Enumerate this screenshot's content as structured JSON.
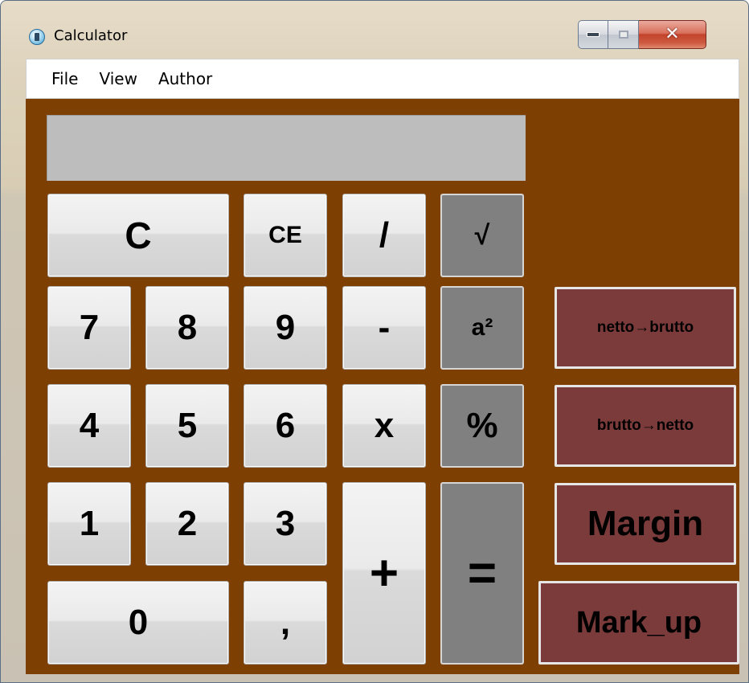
{
  "window": {
    "title": "Calculator"
  },
  "menu": {
    "items": [
      "File",
      "View",
      "Author"
    ]
  },
  "display": {
    "value": ""
  },
  "keys": {
    "clear": "C",
    "clear_entry": "CE",
    "divide": "/",
    "sqrt": "√",
    "seven": "7",
    "eight": "8",
    "nine": "9",
    "minus": "-",
    "square": "a²",
    "four": "4",
    "five": "5",
    "six": "6",
    "multiply": "x",
    "percent": "%",
    "one": "1",
    "two": "2",
    "three": "3",
    "plus": "+",
    "equals": "=",
    "zero": "0",
    "comma": ","
  },
  "functions": {
    "netto_brutto": "netto→brutto",
    "brutto_netto": "brutto→netto",
    "margin": "Margin",
    "mark_up": "Mark_up"
  },
  "colors": {
    "background": "#7e3f03",
    "display": "#bdbdbd",
    "function_button": "#7c3b3b",
    "operator_dark": "#808080"
  }
}
